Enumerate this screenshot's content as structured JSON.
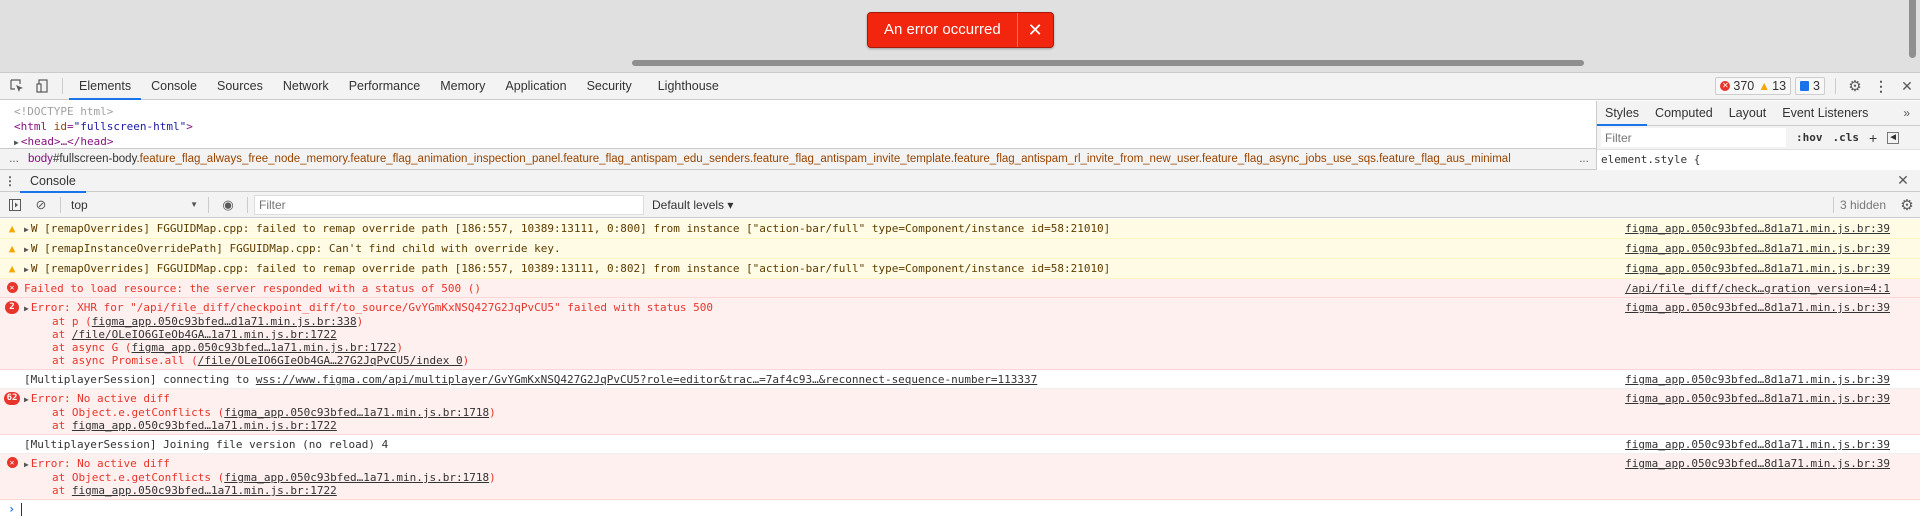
{
  "toast": {
    "message": "An error occurred",
    "close_icon": "close-icon"
  },
  "devtools": {
    "tabs": [
      "Elements",
      "Console",
      "Sources",
      "Network",
      "Performance",
      "Memory",
      "Application",
      "Security",
      "Lighthouse"
    ],
    "active_tab": "Elements",
    "counts": {
      "errors": "370",
      "warnings": "13",
      "messages": "3"
    }
  },
  "elements": {
    "doctype": "<!DOCTYPE html>",
    "html_tag_open": "<html",
    "html_attr_name": "id",
    "html_attr_value": "\"fullscreen-html\"",
    "html_tag_close": ">",
    "head_collapsed": "<head>…</head>",
    "breadcrumb": {
      "leading": "...",
      "tag": "body",
      "id": "#fullscreen-body",
      "classes": ".feature_flag_always_free_node_memory.feature_flag_animation_inspection_panel.feature_flag_antispam_edu_senders.feature_flag_antispam_invite_template.feature_flag_antispam_rl_invite_from_new_user.feature_flag_async_jobs_use_sqs.feature_flag_aus_minimal",
      "trailing": "..."
    }
  },
  "styles": {
    "tabs": [
      "Styles",
      "Computed",
      "Layout",
      "Event Listeners"
    ],
    "active_tab": "Styles",
    "more": "»",
    "filter_placeholder": "Filter",
    "hov": ":hov",
    "cls": ".cls",
    "add": "+",
    "element_style": "element.style {"
  },
  "drawer": {
    "tab": "Console",
    "context": "top",
    "filter_placeholder": "Filter",
    "levels": "Default levels ▾",
    "hidden": "3 hidden"
  },
  "console": {
    "rows": [
      {
        "level": "warn",
        "text": "W [remapOverrides] FGGUIDMap.cpp: failed to remap override path [186:557, 10389:13111, 0:800] from instance [\"action-bar/full\" type=Component/instance id=58:21010]",
        "source": "figma_app.050c93bfed…8d1a71.min.js.br:39"
      },
      {
        "level": "warn",
        "text": "W [remapInstanceOverridePath] FGGUIDMap.cpp: Can't find child with override key.",
        "source": "figma_app.050c93bfed…8d1a71.min.js.br:39"
      },
      {
        "level": "warn",
        "text": "W [remapOverrides] FGGUIDMap.cpp: failed to remap override path [186:557, 10389:13111, 0:802] from instance [\"action-bar/full\" type=Component/instance id=58:21010]",
        "source": "figma_app.050c93bfed…8d1a71.min.js.br:39"
      },
      {
        "level": "error",
        "text": "Failed to load resource: the server responded with a status of 500 ()",
        "source": "/api/file_diff/check…gration_version=4:1"
      },
      {
        "level": "error",
        "count": "2",
        "text": "Error: XHR for \"/api/file_diff/checkpoint_diff/to_source/GvYGmKxNSQ427G2JqPvCU5\" failed with status 500",
        "source": "figma_app.050c93bfed…8d1a71.min.js.br:39",
        "stack": [
          {
            "prefix": "at p (",
            "link": "figma_app.050c93bfed…d1a71.min.js.br:338",
            "suffix": ")"
          },
          {
            "prefix": "at ",
            "link": "/file/OLeIO6GIeOb4GA…1a71.min.js.br:1722",
            "suffix": ""
          },
          {
            "prefix": "at async G (",
            "link": "figma_app.050c93bfed…1a71.min.js.br:1722",
            "suffix": ")"
          },
          {
            "prefix": "at async Promise.all (",
            "link": "/file/OLeIO6GIeOb4GA…27G2JqPvCU5/index 0",
            "suffix": ")"
          }
        ]
      },
      {
        "level": "info",
        "text": "[MultiplayerSession] connecting to ",
        "link": "wss://www.figma.com/api/multiplayer/GvYGmKxNSQ427G2JqPvCU5?role=editor&trac…=7af4c93…&reconnect-sequence-number=113337",
        "source": "figma_app.050c93bfed…8d1a71.min.js.br:39"
      },
      {
        "level": "error",
        "count": "62",
        "text": "Error: No active diff",
        "source": "figma_app.050c93bfed…8d1a71.min.js.br:39",
        "stack": [
          {
            "prefix": "at Object.e.getConflicts (",
            "link": "figma_app.050c93bfed…1a71.min.js.br:1718",
            "suffix": ")"
          },
          {
            "prefix": "at ",
            "link": "figma_app.050c93bfed…1a71.min.js.br:1722",
            "suffix": ""
          }
        ]
      },
      {
        "level": "info",
        "text": "[MultiplayerSession] Joining file version (no reload) 4",
        "source": "figma_app.050c93bfed…8d1a71.min.js.br:39"
      },
      {
        "level": "error",
        "text": "Error: No active diff",
        "source": "figma_app.050c93bfed…8d1a71.min.js.br:39",
        "stack": [
          {
            "prefix": "at Object.e.getConflicts (",
            "link": "figma_app.050c93bfed…1a71.min.js.br:1718",
            "suffix": ")"
          },
          {
            "prefix": "at ",
            "link": "figma_app.050c93bfed…1a71.min.js.br:1722",
            "suffix": ""
          }
        ]
      }
    ],
    "prompt_symbol": "›"
  },
  "colors": {
    "toast_bg": "#f2260f",
    "error": "#e8352b",
    "warning": "#f3a700",
    "accent": "#1a73e8"
  }
}
